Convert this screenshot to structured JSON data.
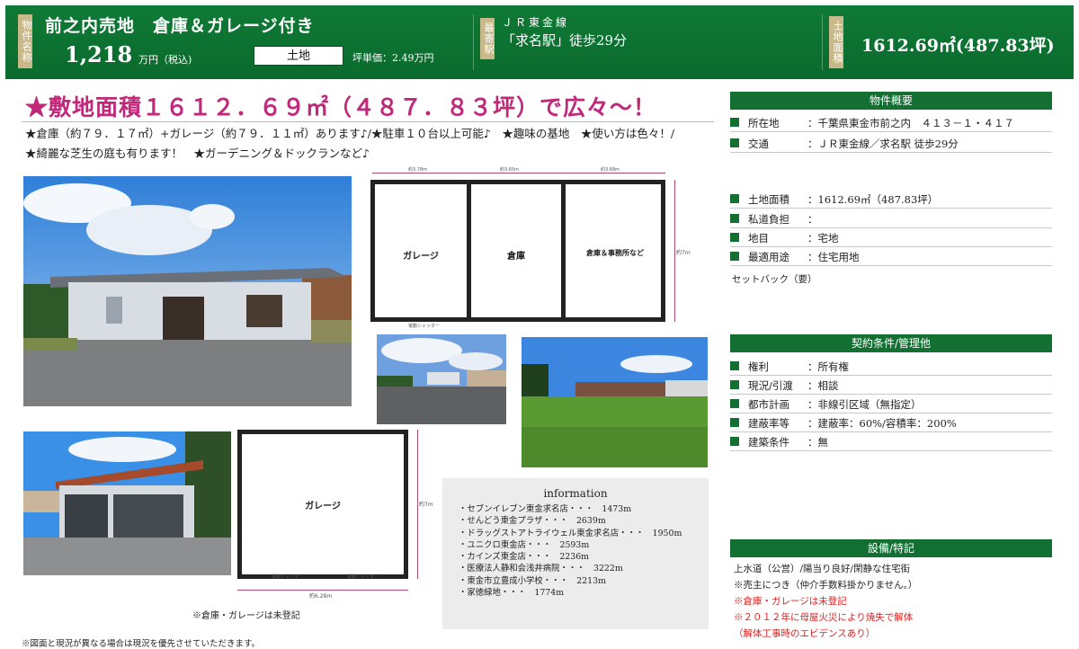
{
  "header": {
    "label_name": "物件名称",
    "name": "前之内売地　倉庫＆ガレージ付き",
    "price": "1,218",
    "price_unit": "万円（税込)",
    "type": "土地",
    "tsubo_price": "坪単価：2.49万円",
    "label_station": "最寄駅",
    "line": "ＪＲ東金線",
    "station": "「求名駅」徒歩29分",
    "label_area": "土地面積",
    "area": "1612.69㎡(487.83坪)"
  },
  "headline": "★敷地面積１６１２．６９㎡（４８７．８３坪）で広々～！",
  "description": [
    "★倉庫（約７９．１７㎡）+ガレージ（約７９．１１㎡）あります♪/★駐車１０台以上可能♪　★趣味の基地　★使い方は色々！/",
    "★綺麗な芝生の庭も有ります！　★ガーデニング＆ドックランなど♪"
  ],
  "floorplan_main": {
    "rooms": [
      "ガレージ",
      "倉庫",
      "倉庫＆事務所など"
    ],
    "top_dims": [
      "約3.78m",
      "約3.65m",
      "約3.68m"
    ],
    "side_dim": "約7m",
    "shutter": "電動シャッター"
  },
  "floorplan_garage": {
    "room": "ガレージ",
    "side_dim": "約7m",
    "shutters": [
      "電動シャッター",
      "電動シャッター"
    ],
    "bottom_dim": "約6.28m"
  },
  "notes": {
    "unregistered": "※倉庫・ガレージは未登記",
    "disclaimer": "※図面と現況が異なる場合は現況を優先させていただきます。"
  },
  "information": {
    "title": "information",
    "items": [
      "・セブンイレブン東金求名店・・・　1473m",
      "・せんどう東金プラザ・・・　2639m",
      "・ドラッグストアトライウェル東金求名店・・・　1950m",
      "・ユニクロ東金店・・・　2593m",
      "・カインズ東金店・・・　2236m",
      "・医療法人静和会浅井病院・・・　3222m",
      "・東金市立豊成小学校・・・　2213m",
      "・家徳緑地・・・　1774m"
    ]
  },
  "overview": {
    "title": "物件概要",
    "rows_a": [
      {
        "label": "所在地",
        "value": "：千葉県東金市前之内　４１３－１・４１７"
      },
      {
        "label": "交通",
        "value": "：ＪＲ東金線／求名駅 徒歩29分"
      }
    ],
    "rows_b": [
      {
        "label": "土地面積",
        "value": "：1612.69㎡（487.83坪）"
      },
      {
        "label": "私道負担",
        "value": "："
      },
      {
        "label": "地目",
        "value": "：宅地"
      },
      {
        "label": "最適用途",
        "value": "：住宅用地"
      }
    ],
    "setback": "セットバック（要）"
  },
  "contract": {
    "title": "契約条件/管理他",
    "rows": [
      {
        "label": "権利",
        "value": "：所有権"
      },
      {
        "label": "現況/引渡",
        "value": "：相談"
      },
      {
        "label": "都市計画",
        "value": "：非線引区域（無指定）"
      },
      {
        "label": "建蔽率等",
        "value": "：建蔽率：60%/容積率：200%"
      },
      {
        "label": "建築条件",
        "value": "：無"
      }
    ]
  },
  "features": {
    "title": "設備/特記",
    "lines": [
      "上水道（公営）/陽当り良好/閑静な住宅街",
      "※売主につき（仲介手数料掛かりません。）"
    ],
    "red_lines": [
      "※倉庫・ガレージは未登記",
      "※２０１２年に母屋火災により焼失で解体",
      "（解体工事時のエビデンスあり）"
    ]
  },
  "colors": {
    "header_green": "#0f7a36",
    "label_gold": "#c9b98a",
    "headline_pink": "#c0287a",
    "note_red": "#e02020"
  }
}
